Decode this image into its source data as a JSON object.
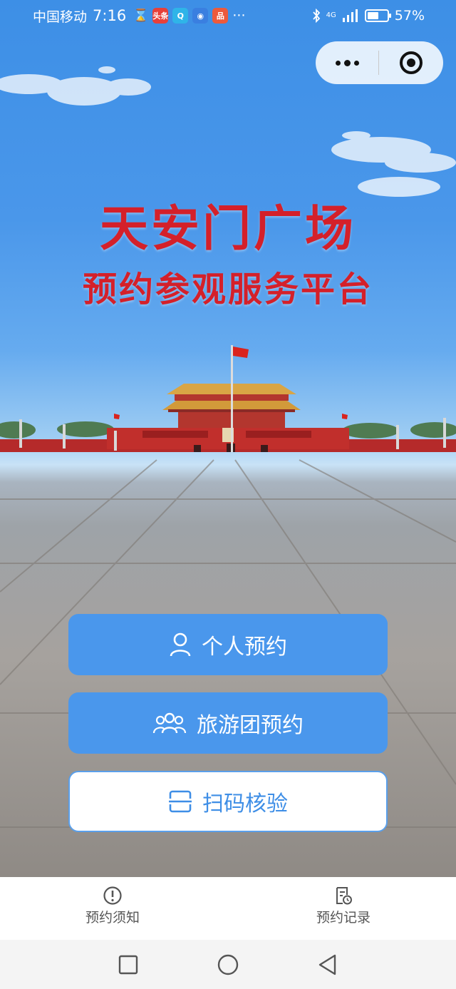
{
  "status_bar": {
    "carrier": "中国移动",
    "time": "7:16",
    "hourglass": "⌛",
    "apps": [
      {
        "icon": "toutiao-app-icon",
        "label": "头条",
        "color": "#e8403a"
      },
      {
        "icon": "search-app-icon",
        "label": "Q",
        "color": "#2fb4e8"
      },
      {
        "icon": "browser-app-icon",
        "label": "◉",
        "color": "#3a7fe0"
      },
      {
        "icon": "shopping-app-icon",
        "label": "品",
        "color": "#ec5a3c"
      }
    ],
    "more": "···",
    "network": "4G",
    "battery_percent": 57,
    "battery_label": "57%"
  },
  "hero": {
    "title": "天安门广场",
    "subtitle": "预约参观服务平台"
  },
  "actions": {
    "personal": {
      "label": "个人预约",
      "icon": "person-icon"
    },
    "group": {
      "label": "旅游团预约",
      "icon": "group-icon"
    },
    "scan": {
      "label": "扫码核验",
      "icon": "scan-icon"
    }
  },
  "tabs": [
    {
      "label": "预约须知",
      "icon": "info-circle-icon"
    },
    {
      "label": "预约记录",
      "icon": "record-document-icon"
    }
  ],
  "colors": {
    "accent": "#4a97ec",
    "title_red": "#d4202a",
    "outline_text": "#3e8ee6"
  }
}
